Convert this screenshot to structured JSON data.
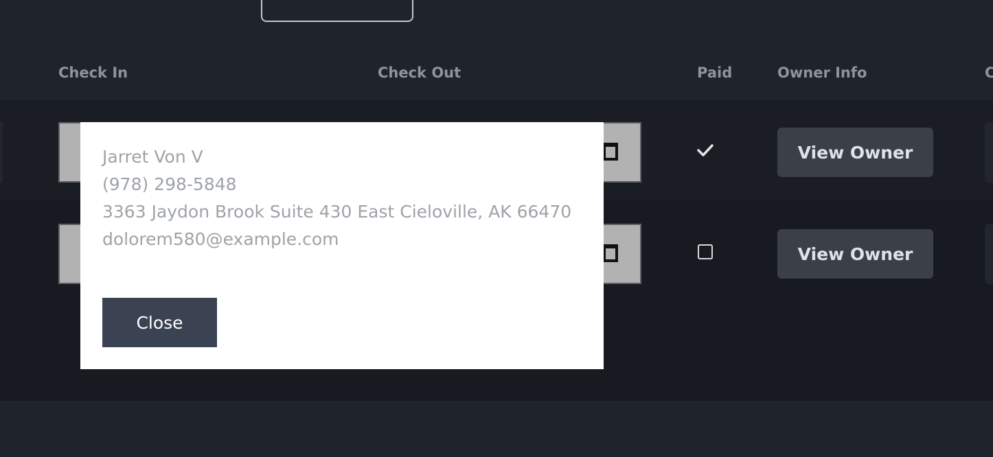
{
  "table": {
    "headers": [
      "Check In",
      "Check Out",
      "Paid",
      "Owner Info",
      "C"
    ],
    "rows": [
      {
        "paid": true,
        "owner_button": "View Owner"
      },
      {
        "paid": false,
        "owner_button": "View Owner"
      }
    ]
  },
  "modal": {
    "owner_name": "Jarret Von V",
    "phone": "(978) 298-5848",
    "address": "3363 Jaydon Brook Suite 430 East Cieloville, AK 66470",
    "email": "dolorem580@example.com",
    "close_label": "Close"
  },
  "icons": {
    "paid_true": "check-icon",
    "paid_false": "checkbox-icon",
    "date": "calendar-icon"
  }
}
